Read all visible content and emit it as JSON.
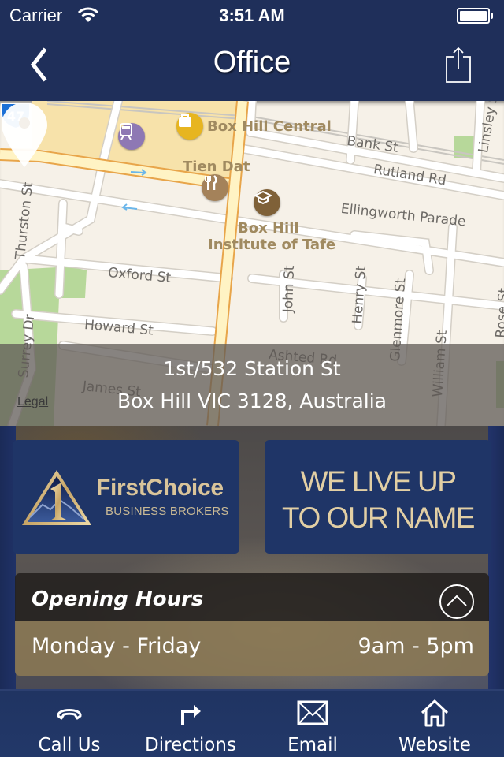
{
  "status_bar": {
    "carrier": "Carrier",
    "time": "3:51 AM",
    "battery_level": 1.0
  },
  "nav": {
    "title": "Office",
    "back_icon": "chevron-left-icon",
    "share_icon": "share-icon"
  },
  "map": {
    "streets": [
      "Bank St",
      "Rutland Rd",
      "Ellingworth Parade",
      "Oxford St",
      "Howard St",
      "James St",
      "Ashted Rd",
      "Thurston St",
      "Surrey Dr",
      "John St",
      "Henry St",
      "Glenmore St",
      "William St",
      "Linsley St",
      "Rose St"
    ],
    "pois": [
      {
        "name": "Box Hill Central",
        "icon": "shopping-icon"
      },
      {
        "name": "Tien Dat",
        "icon": "restaurant-icon"
      },
      {
        "name_line1": "Box Hill",
        "name_line2": "Institute of Tafe",
        "icon": "education-icon"
      },
      {
        "name": "",
        "icon": "train-icon"
      }
    ],
    "route_shield": "47",
    "legal_label": "Legal"
  },
  "address": {
    "line1": "1st/532 Station St",
    "line2": "Box Hill VIC 3128, Australia"
  },
  "logo": {
    "name": "FirstChoice",
    "subtitle": "BUSINESS BROKERS"
  },
  "slogan": {
    "line1": "WE LIVE UP",
    "line2": "TO OUR NAME"
  },
  "opening_hours": {
    "title": "Opening Hours",
    "rows": [
      {
        "days": "Monday - Friday",
        "hours": "9am - 5pm"
      }
    ]
  },
  "tabs": [
    {
      "label": "Call Us",
      "icon": "phone-icon"
    },
    {
      "label": "Directions",
      "icon": "directions-icon"
    },
    {
      "label": "Email",
      "icon": "envelope-icon"
    },
    {
      "label": "Website",
      "icon": "home-icon"
    }
  ],
  "colors": {
    "navy": "#1f2f5a",
    "tile_blue": "#1f3567",
    "gold": "#d9c49a",
    "hours_row": "#8a7854"
  }
}
